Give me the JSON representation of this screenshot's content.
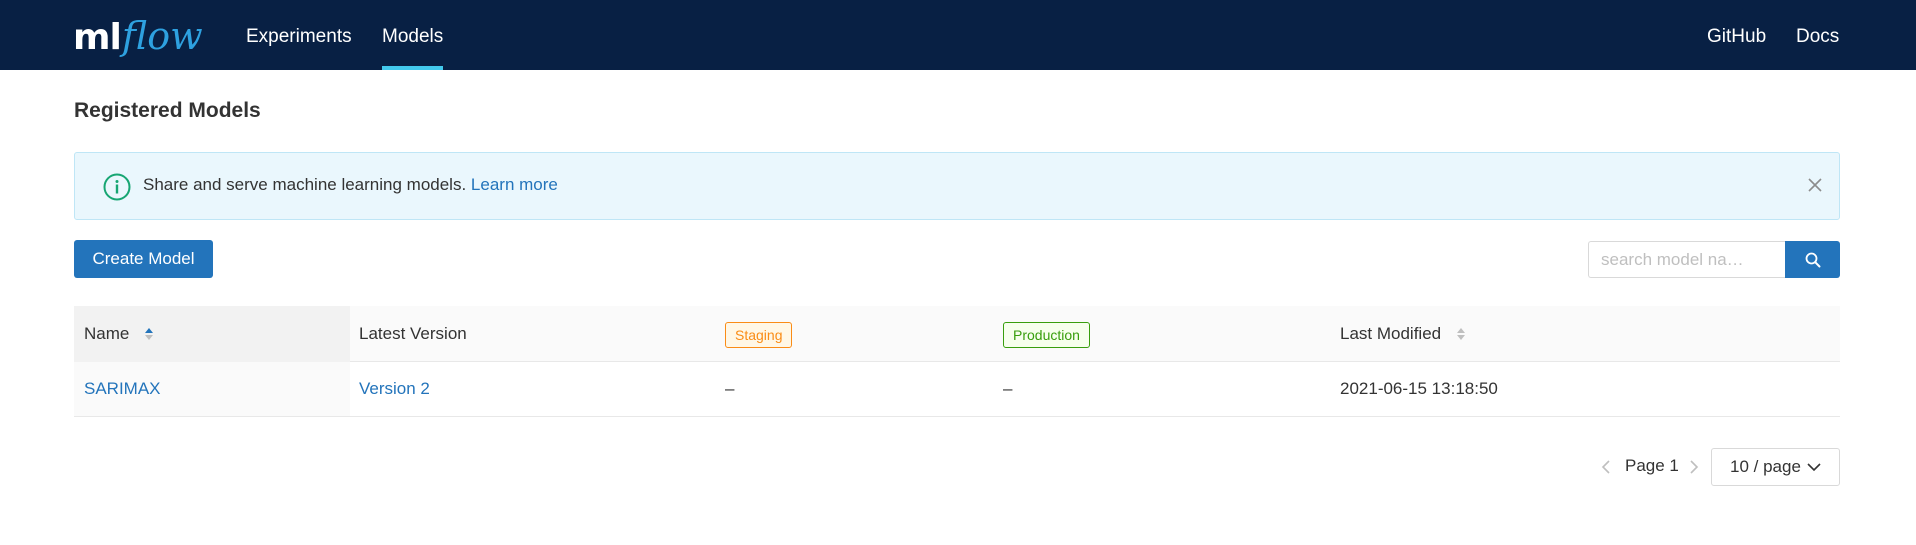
{
  "header": {
    "logo_ml": "ml",
    "logo_flow": "flow",
    "nav": [
      {
        "label": "Experiments",
        "active": false
      },
      {
        "label": "Models",
        "active": true
      }
    ],
    "right_links": [
      "GitHub",
      "Docs"
    ],
    "colors": {
      "background": "#082044",
      "accent": "#43c9ed",
      "logo_flow": "#2ea1e0"
    }
  },
  "page": {
    "title": "Registered Models"
  },
  "alert": {
    "icon": "info-circle-icon",
    "text": "Share and serve machine learning models.",
    "link": "Learn more",
    "close_icon": "close-icon"
  },
  "toolbar": {
    "create_label": "Create Model",
    "search_placeholder": "search model na…",
    "search_icon": "search-icon",
    "primary_color": "#2374bb"
  },
  "table": {
    "columns": {
      "name": "Name",
      "latest": "Latest Version",
      "staging": "Staging",
      "production": "Production",
      "modified": "Last Modified"
    },
    "rows": [
      {
        "name": "SARIMAX",
        "latest": "Version 2",
        "staging": "–",
        "production": "–",
        "modified": "2021-06-15 13:18:50"
      }
    ]
  },
  "pagination": {
    "page_label": "Page 1",
    "page_size": "10 / page"
  }
}
